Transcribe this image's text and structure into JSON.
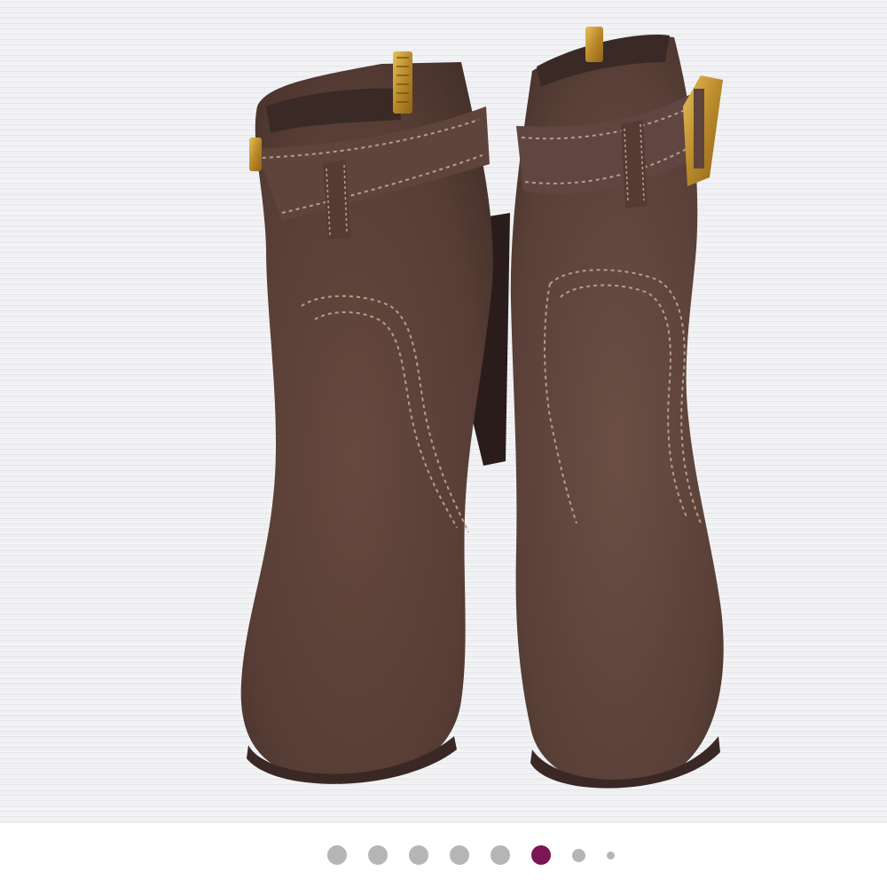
{
  "gallery": {
    "image": {
      "subject_icon": "suede-ankle-boots-photo",
      "colors": {
        "suede": "#5a4038",
        "suede_dark": "#3f2b26",
        "suede_light": "#6e5249",
        "stitch": "#b59d8c",
        "hardware": "#c79a2e",
        "heel": "#2a1c1a",
        "background_stripes": "#e8e9ec"
      }
    },
    "pagination": {
      "total": 8,
      "active_index": 5,
      "colors": {
        "inactive": "#b5b5b5",
        "active": "#7a1556"
      },
      "dots": [
        {
          "size": "normal",
          "active": false
        },
        {
          "size": "normal",
          "active": false
        },
        {
          "size": "normal",
          "active": false
        },
        {
          "size": "normal",
          "active": false
        },
        {
          "size": "normal",
          "active": false
        },
        {
          "size": "normal",
          "active": true
        },
        {
          "size": "small",
          "active": false
        },
        {
          "size": "tiny",
          "active": false
        }
      ]
    }
  }
}
